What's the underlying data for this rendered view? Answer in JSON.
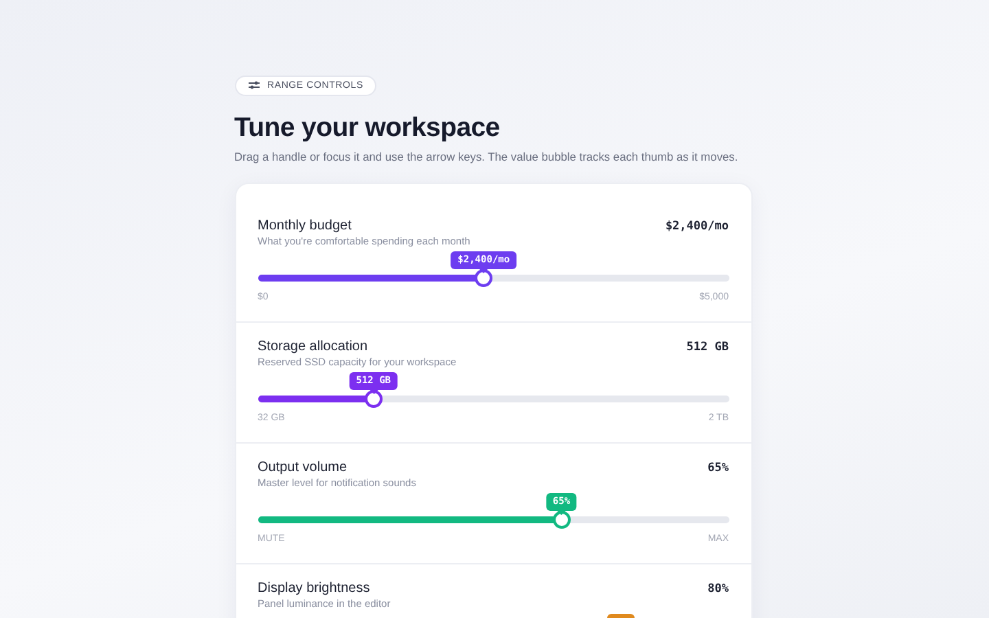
{
  "badge": {
    "label": "RANGE CONTROLS"
  },
  "title": "Tune your workspace",
  "subtitle": "Drag a handle or focus it and use the arrow keys. The value bubble tracks each thumb as it moves.",
  "sliders": [
    {
      "label": "Monthly budget",
      "description": "What you're comfortable spending each month",
      "value": "$2,400/mo",
      "bubble": "$2,400/mo",
      "level": 0.48,
      "color": "#6d3df0",
      "min": "$0",
      "max": "$5,000"
    },
    {
      "label": "Storage allocation",
      "description": "Reserved SSD capacity for your workspace",
      "value": "512 GB",
      "bubble": "512 GB",
      "level": 0.246,
      "color": "#7c2ff0",
      "min": "32 GB",
      "max": "2 TB"
    },
    {
      "label": "Output volume",
      "description": "Master level for notification sounds",
      "value": "65%",
      "bubble": "65%",
      "level": 0.645,
      "color": "#12b981",
      "min": "MUTE",
      "max": "MAX"
    },
    {
      "label": "Display brightness",
      "description": "Panel luminance in the editor",
      "value": "80%",
      "level": 0.77,
      "color": "#e08a1e"
    }
  ]
}
